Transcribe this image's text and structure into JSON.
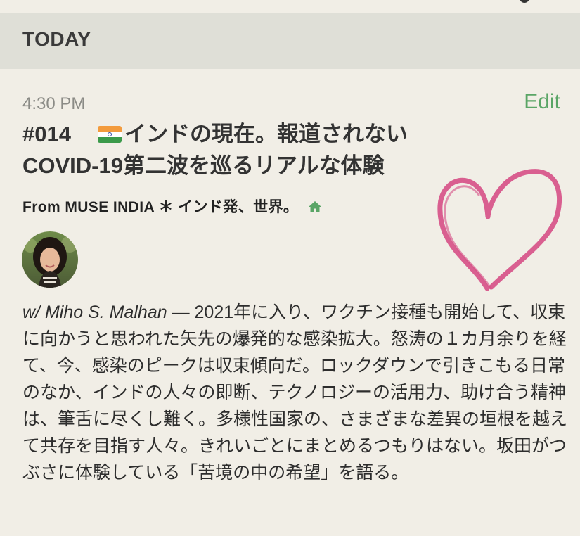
{
  "section": {
    "title": "TODAY"
  },
  "episode": {
    "time": "4:30 PM",
    "edit_label": "Edit",
    "number": "#014",
    "title_part1": "インドの現在。報道されない",
    "title_part2": "COVID-19第二波を巡るリアルな体験",
    "flag_icon": "india-flag-icon",
    "source": "From MUSE INDIA ＊ インド発、世界。",
    "home_icon": "home-icon",
    "guest_prefix": "w/ Miho S. Malhan",
    "description": " — 2021年に入り、ワクチン接種も開始して、収束に向かうと思われた矢先の爆発的な感染拡大。怒涛の１カ月余りを経て、今、感染のピークは収束傾向だ。ロックダウンで引きこもる日常のなか、インドの人々の即断、テクノロジーの活用力、助け合う精神は、筆舌に尽くし難く。多様性国家の、さまざまな差異の垣根を越えて共存を目指す人々。きれいごとにまとめるつもりはない。坂田がつぶさに体験している「苦境の中の希望」を語る。"
  },
  "colors": {
    "background": "#f1eee6",
    "header_bg": "#dfdfd7",
    "accent": "#5aa566",
    "heart": "#d64f86"
  }
}
